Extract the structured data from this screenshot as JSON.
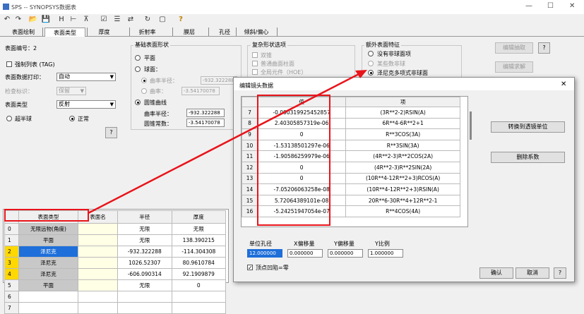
{
  "window": {
    "title": "SPS -- SYNOPSYS数据表",
    "min": "—",
    "max": "☐",
    "close": "✕"
  },
  "toolbar": {
    "icons": [
      "↶",
      "↷",
      "📂",
      "💾",
      "H",
      "⊢",
      "⊼",
      "☑",
      "☰",
      "⇄",
      "↻",
      "▢",
      "?"
    ]
  },
  "tabs": [
    "表面绘制",
    "表面类型",
    "厚度",
    "折射率",
    "膜层",
    "孔径",
    "倾斜/偏心"
  ],
  "active_tab": "表面类型",
  "left": {
    "surface_number_label": "表面编号：2",
    "force_list": "强制列表 (TAG)",
    "data_print_label": "表面数据打印：",
    "data_print_value": "自动",
    "check_label": "检查标识：",
    "check_value": "保留",
    "surface_type_label": "表面类型",
    "surface_type_value": "反射",
    "hyper_label": "超半球",
    "normal_label": "正常",
    "help": "?"
  },
  "basic": {
    "title": "基础表面形状",
    "flat": "平面",
    "sphere": "球面：",
    "sphere_radius_label": "曲率半径：",
    "sphere_radius": "-932.322288",
    "sphere_curv_label": "曲率：",
    "sphere_curv": "-3.54170078",
    "conic": "圆锥曲线",
    "conic_radius_label": "曲率半径：",
    "conic_radius": "-932.322288",
    "conic_k_label": "圆锥常数：",
    "conic_k": "-3.54170078"
  },
  "complex": {
    "title": "复杂形状选项",
    "options": [
      "双锥",
      "普通曲面柱面",
      "全局元件（HOE）",
      "光栅"
    ]
  },
  "extra": {
    "title": "额外表面特征",
    "options": [
      "没有非球面项",
      "某些数非球",
      "泽尼克多项式非球面"
    ]
  },
  "right_buttons": {
    "edit_extract": "编辑抽取",
    "q": "?",
    "edit_request": "编辑求解"
  },
  "grid": {
    "headers": [
      "",
      "表面类型",
      "表面名",
      "半径",
      "厚度"
    ],
    "rows": [
      {
        "n": "0",
        "type": "无限远物(角度)",
        "name": "",
        "radius": "无限",
        "thick": "无限"
      },
      {
        "n": "1",
        "type": "平面",
        "name": "",
        "radius": "无限",
        "thick": "138.390215"
      },
      {
        "n": "2",
        "type": "泽尼克",
        "name": "",
        "radius": "-932.322288",
        "thick": "-114.304308"
      },
      {
        "n": "3",
        "type": "泽尼克",
        "name": "",
        "radius": "1026.52307",
        "thick": "80.9610784"
      },
      {
        "n": "4",
        "type": "泽尼克",
        "name": "",
        "radius": "-606.090314",
        "thick": "92.1909879"
      },
      {
        "n": "5",
        "type": "平面",
        "name": "",
        "radius": "无限",
        "thick": "0"
      },
      {
        "n": "6",
        "type": "",
        "name": "",
        "radius": "",
        "thick": ""
      },
      {
        "n": "7",
        "type": "",
        "name": "",
        "radius": "",
        "thick": ""
      }
    ]
  },
  "dialog": {
    "title": "编辑镜头数据",
    "close": "✕",
    "headers": [
      "",
      "值",
      "项"
    ],
    "rows": [
      {
        "n": "7",
        "v": "-0.000319925452857",
        "t": "(3R**2-2)RSIN(A)"
      },
      {
        "n": "8",
        "v": "2.40305857319e-06",
        "t": "6R**4-6R**2+1"
      },
      {
        "n": "9",
        "v": "0",
        "t": "R**3COS(3A)"
      },
      {
        "n": "10",
        "v": "-1.53138501297e-06",
        "t": "R**3SIN(3A)"
      },
      {
        "n": "11",
        "v": "-1.90586259979e-06",
        "t": "(4R**2-3)R**2COS(2A)"
      },
      {
        "n": "12",
        "v": "0",
        "t": "(4R**2-3)R**2SIN(2A)"
      },
      {
        "n": "13",
        "v": "0",
        "t": "(10R**4-12R**2+3)RCOS(A)"
      },
      {
        "n": "14",
        "v": "-7.05206063258e-08",
        "t": "(10R**4-12R**2+3)RSIN(A)"
      },
      {
        "n": "15",
        "v": "5.72064389101e-08",
        "t": "20R**6-30R**4+12R**2-1"
      },
      {
        "n": "16",
        "v": "-5.24251947054e-07",
        "t": "R**4COS(4A)"
      }
    ],
    "convert_btn": "转换到透镜单位",
    "delete_btn": "删除系数",
    "unit_label": "单位孔径",
    "unit_value": "12.000000",
    "xoff_label": "X偏移量",
    "xoff_value": "0.000000",
    "yoff_label": "Y偏移量",
    "yoff_value": "0.000000",
    "yscale_label": "Y比例",
    "yscale_value": "1.000000",
    "zero_check": "顶点凹陷=零",
    "ok": "确认",
    "cancel": "取消",
    "help": "?"
  },
  "colors": {
    "highlight": "#1e6fd9",
    "red": "#e8141a"
  }
}
